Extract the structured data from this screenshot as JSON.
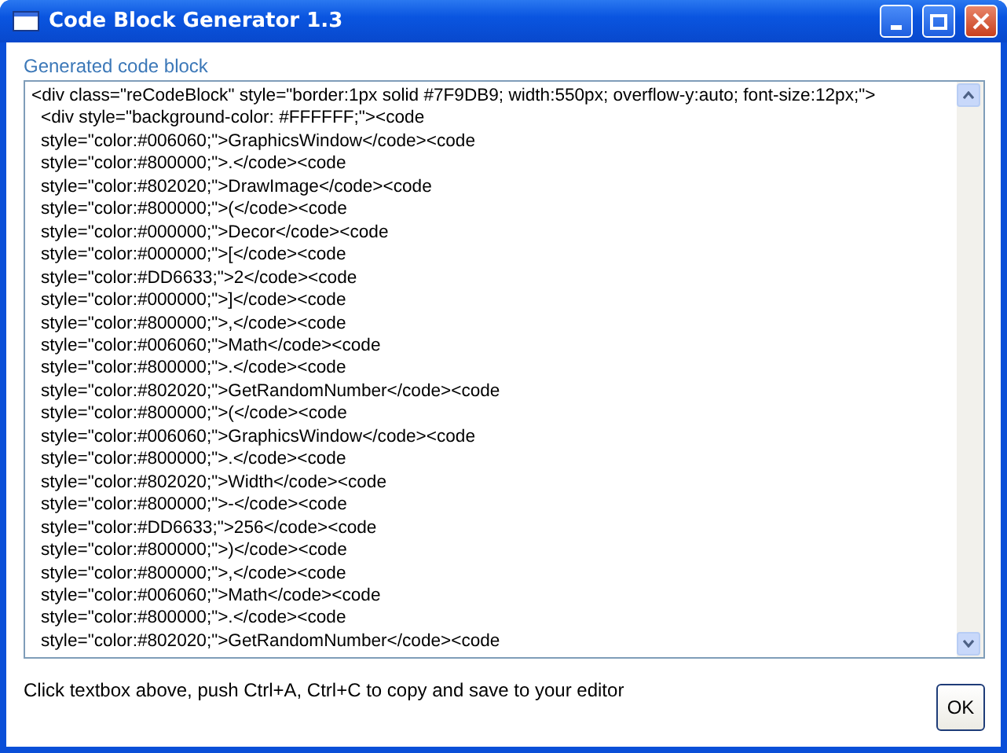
{
  "window": {
    "title": "Code Block Generator 1.3"
  },
  "code_block": {
    "label": "Generated code block",
    "lines": [
      "<div class=\"reCodeBlock\" style=\"border:1px solid #7F9DB9; width:550px; overflow-y:auto; font-size:12px;\">",
      "<div style=\"background-color: #FFFFFF;\"><code",
      "style=\"color:#006060;\">GraphicsWindow</code><code",
      "style=\"color:#800000;\">.</code><code",
      "style=\"color:#802020;\">DrawImage</code><code",
      "style=\"color:#800000;\">(</code><code",
      "style=\"color:#000000;\">Decor</code><code",
      "style=\"color:#000000;\">[</code><code",
      "style=\"color:#DD6633;\">2</code><code",
      "style=\"color:#000000;\">]</code><code",
      "style=\"color:#800000;\">,</code><code",
      "style=\"color:#006060;\">Math</code><code",
      "style=\"color:#800000;\">.</code><code",
      "style=\"color:#802020;\">GetRandomNumber</code><code",
      "style=\"color:#800000;\">(</code><code",
      "style=\"color:#006060;\">GraphicsWindow</code><code",
      "style=\"color:#800000;\">.</code><code",
      "style=\"color:#802020;\">Width</code><code",
      "style=\"color:#800000;\">-</code><code",
      "style=\"color:#DD6633;\">256</code><code",
      "style=\"color:#800000;\">)</code><code",
      "style=\"color:#800000;\">,</code><code",
      "style=\"color:#006060;\">Math</code><code",
      "style=\"color:#800000;\">.</code><code",
      "style=\"color:#802020;\">GetRandomNumber</code><code"
    ]
  },
  "hint": "Click textbox above, push Ctrl+A, Ctrl+C to copy and save to your editor",
  "buttons": [
    "OK"
  ]
}
